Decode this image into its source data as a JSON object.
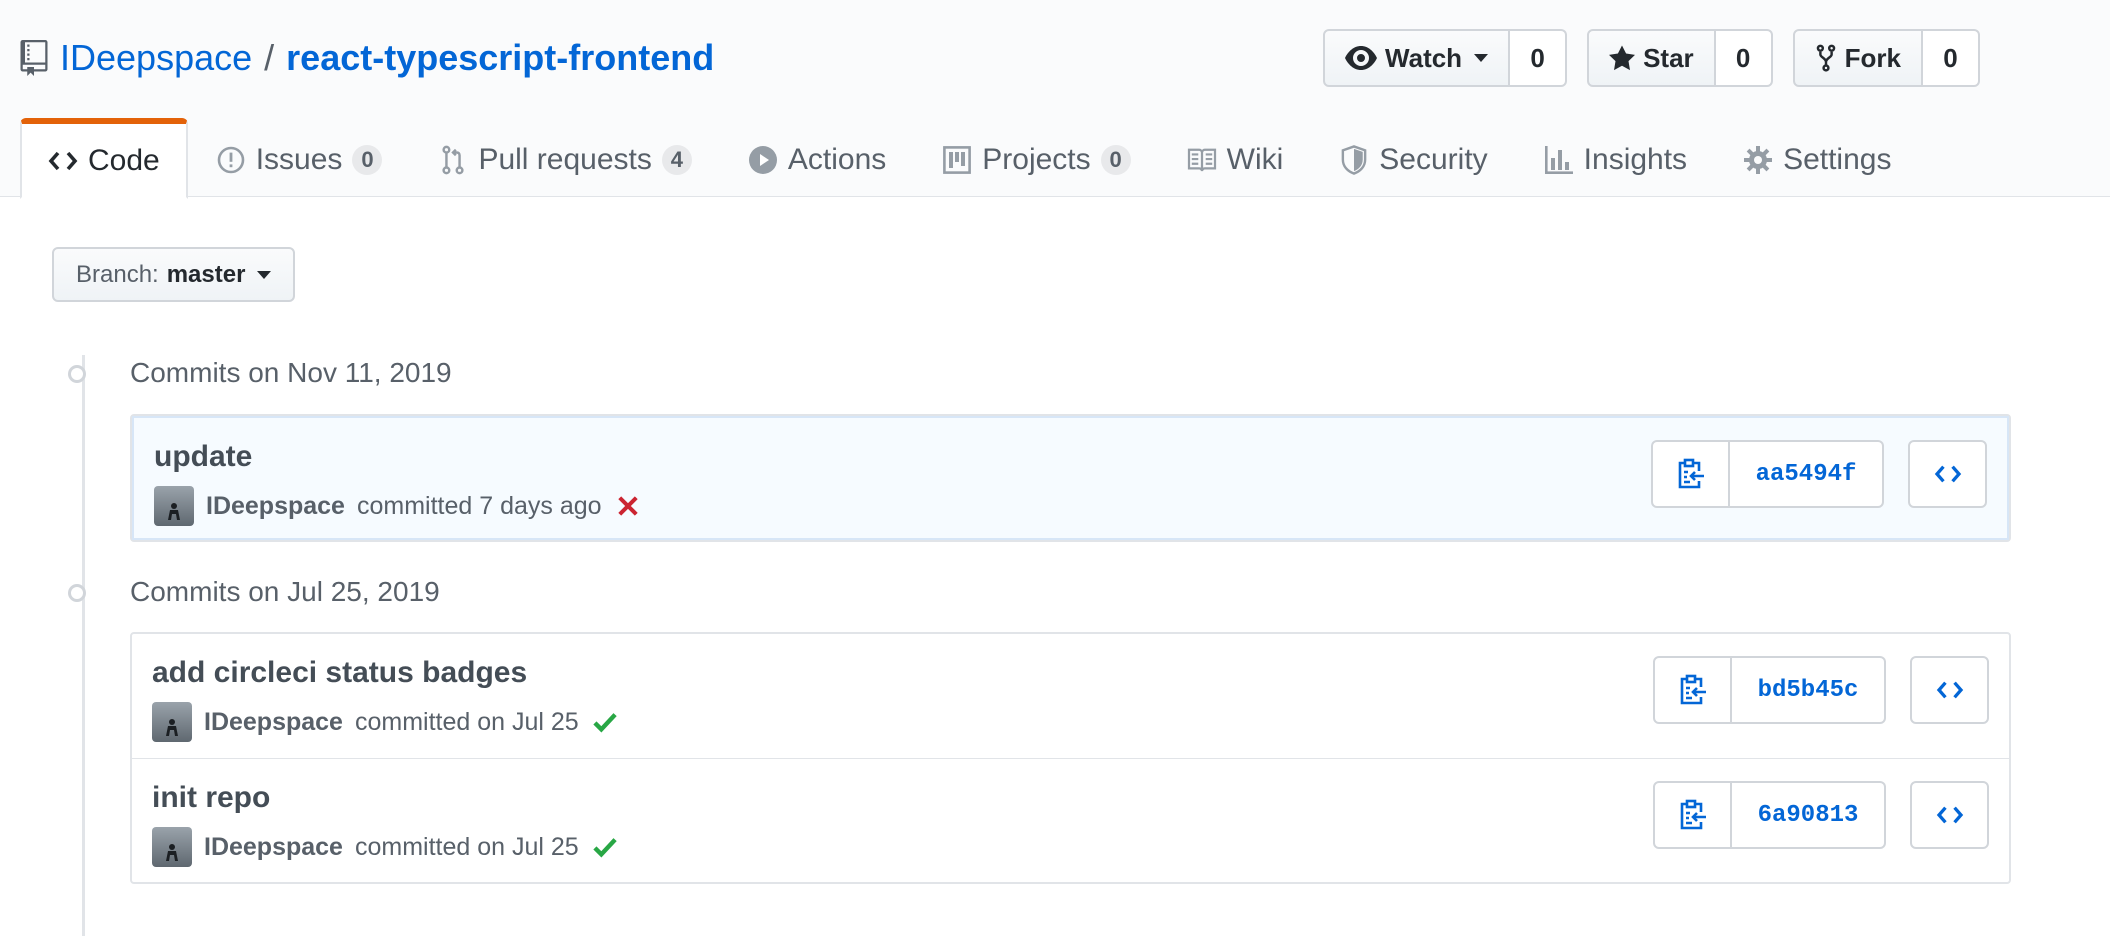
{
  "repo": {
    "owner": "IDeepspace",
    "separator": "/",
    "name": "react-typescript-frontend"
  },
  "actions": {
    "watch": {
      "label": "Watch",
      "count": "0"
    },
    "star": {
      "label": "Star",
      "count": "0"
    },
    "fork": {
      "label": "Fork",
      "count": "0"
    }
  },
  "tabs": [
    {
      "label": "Code",
      "icon": "code-icon"
    },
    {
      "label": "Issues",
      "count": "0",
      "icon": "issue-icon"
    },
    {
      "label": "Pull requests",
      "count": "4",
      "icon": "pull-request-icon"
    },
    {
      "label": "Actions",
      "icon": "play-icon"
    },
    {
      "label": "Projects",
      "count": "0",
      "icon": "project-icon"
    },
    {
      "label": "Wiki",
      "icon": "book-icon"
    },
    {
      "label": "Security",
      "icon": "shield-icon"
    },
    {
      "label": "Insights",
      "icon": "graph-icon"
    },
    {
      "label": "Settings",
      "icon": "gear-icon"
    }
  ],
  "branch": {
    "prefix": "Branch:",
    "name": "master"
  },
  "groups": [
    {
      "title": "Commits on Nov 11, 2019",
      "commits": [
        {
          "message": "update",
          "author": "IDeepspace",
          "when": "committed 7 days ago",
          "status": "failure",
          "sha": "aa5494f"
        }
      ]
    },
    {
      "title": "Commits on Jul 25, 2019",
      "commits": [
        {
          "message": "add circleci status badges",
          "author": "IDeepspace",
          "when": "committed on Jul 25",
          "status": "success",
          "sha": "bd5b45c"
        },
        {
          "message": "init repo",
          "author": "IDeepspace",
          "when": "committed on Jul 25",
          "status": "success",
          "sha": "6a90813"
        }
      ]
    }
  ],
  "colors": {
    "link": "#0366d6",
    "tab_accent": "#e36209",
    "success": "#28a745",
    "failure": "#cb2431"
  }
}
